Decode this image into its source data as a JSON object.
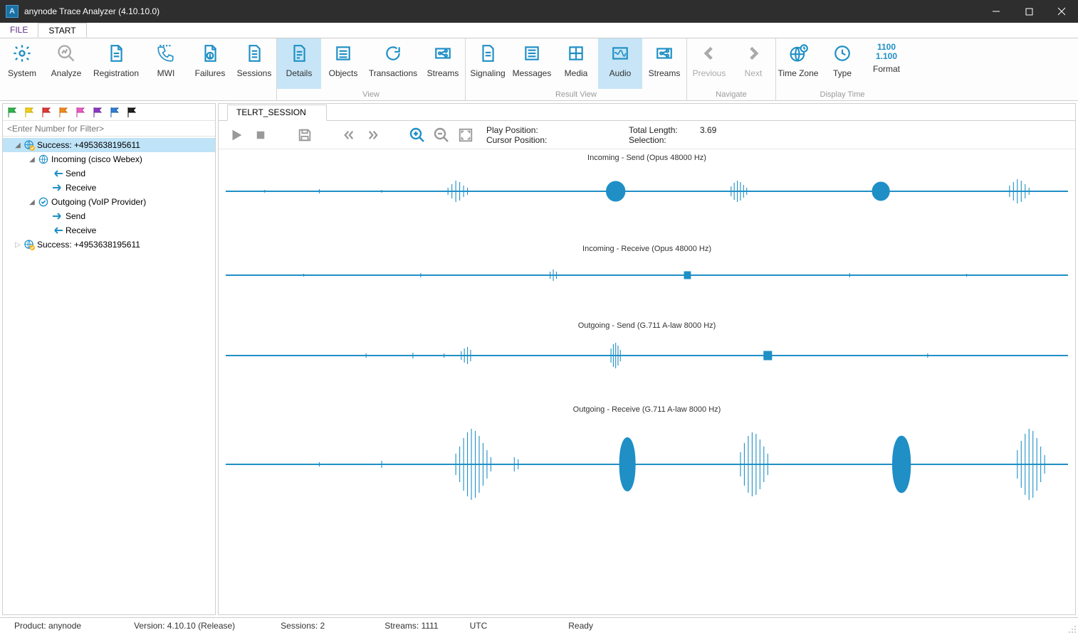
{
  "window": {
    "title": "anynode Trace Analyzer (4.10.10.0)"
  },
  "menu": {
    "file": "FILE",
    "start": "START"
  },
  "ribbon": {
    "groups": {
      "first": [
        {
          "id": "system",
          "label": "System"
        },
        {
          "id": "analyze",
          "label": "Analyze"
        },
        {
          "id": "registration",
          "label": "Registration"
        },
        {
          "id": "mwi",
          "label": "MWI"
        },
        {
          "id": "failures",
          "label": "Failures"
        },
        {
          "id": "sessions",
          "label": "Sessions"
        }
      ],
      "view_label": "View",
      "view": [
        {
          "id": "details",
          "label": "Details",
          "active": true
        },
        {
          "id": "objects",
          "label": "Objects"
        },
        {
          "id": "transactions",
          "label": "Transactions"
        },
        {
          "id": "streams",
          "label": "Streams"
        }
      ],
      "result_label": "Result View",
      "result": [
        {
          "id": "signaling",
          "label": "Signaling"
        },
        {
          "id": "messages",
          "label": "Messages"
        },
        {
          "id": "media",
          "label": "Media"
        },
        {
          "id": "audio",
          "label": "Audio",
          "active": true
        },
        {
          "id": "rstreams",
          "label": "Streams"
        }
      ],
      "navigate_label": "Navigate",
      "navigate": [
        {
          "id": "previous",
          "label": "Previous"
        },
        {
          "id": "next",
          "label": "Next"
        }
      ],
      "display_label": "Display Time",
      "display": [
        {
          "id": "timezone",
          "label": "Time Zone"
        },
        {
          "id": "type",
          "label": "Type"
        }
      ],
      "format": {
        "label": "Format",
        "l1": "1100",
        "l2": "1.100"
      }
    }
  },
  "side": {
    "filter_placeholder": "<Enter Number for Filter>",
    "nodes": {
      "n0": "Success: +4953638195611",
      "n1": "Incoming (cisco Webex)",
      "n2": "Send",
      "n3": "Receive",
      "n4": "Outgoing (VoIP Provider)",
      "n5": "Send",
      "n6": "Receive",
      "n7": "Success: +4953638195611"
    }
  },
  "main": {
    "tab": "TELRT_SESSION",
    "info": {
      "play_pos_k": "Play Position:",
      "play_pos_v": "",
      "total_k": "Total Length:",
      "total_v": "3.69",
      "cursor_k": "Cursor Position:",
      "cursor_v": "",
      "sel_k": "Selection:",
      "sel_v": ""
    },
    "tracks": [
      "Incoming - Send (Opus 48000 Hz)",
      "Incoming - Receive (Opus 48000 Hz)",
      "Outgoing - Send (G.711 A-law 8000 Hz)",
      "Outgoing - Receive (G.711 A-law 8000 Hz)"
    ]
  },
  "status": {
    "product": "Product: anynode",
    "version": "Version: 4.10.10 (Release)",
    "sessions": "Sessions: 2",
    "streams": "Streams: 1111",
    "tz": "UTC",
    "ready": "Ready"
  }
}
